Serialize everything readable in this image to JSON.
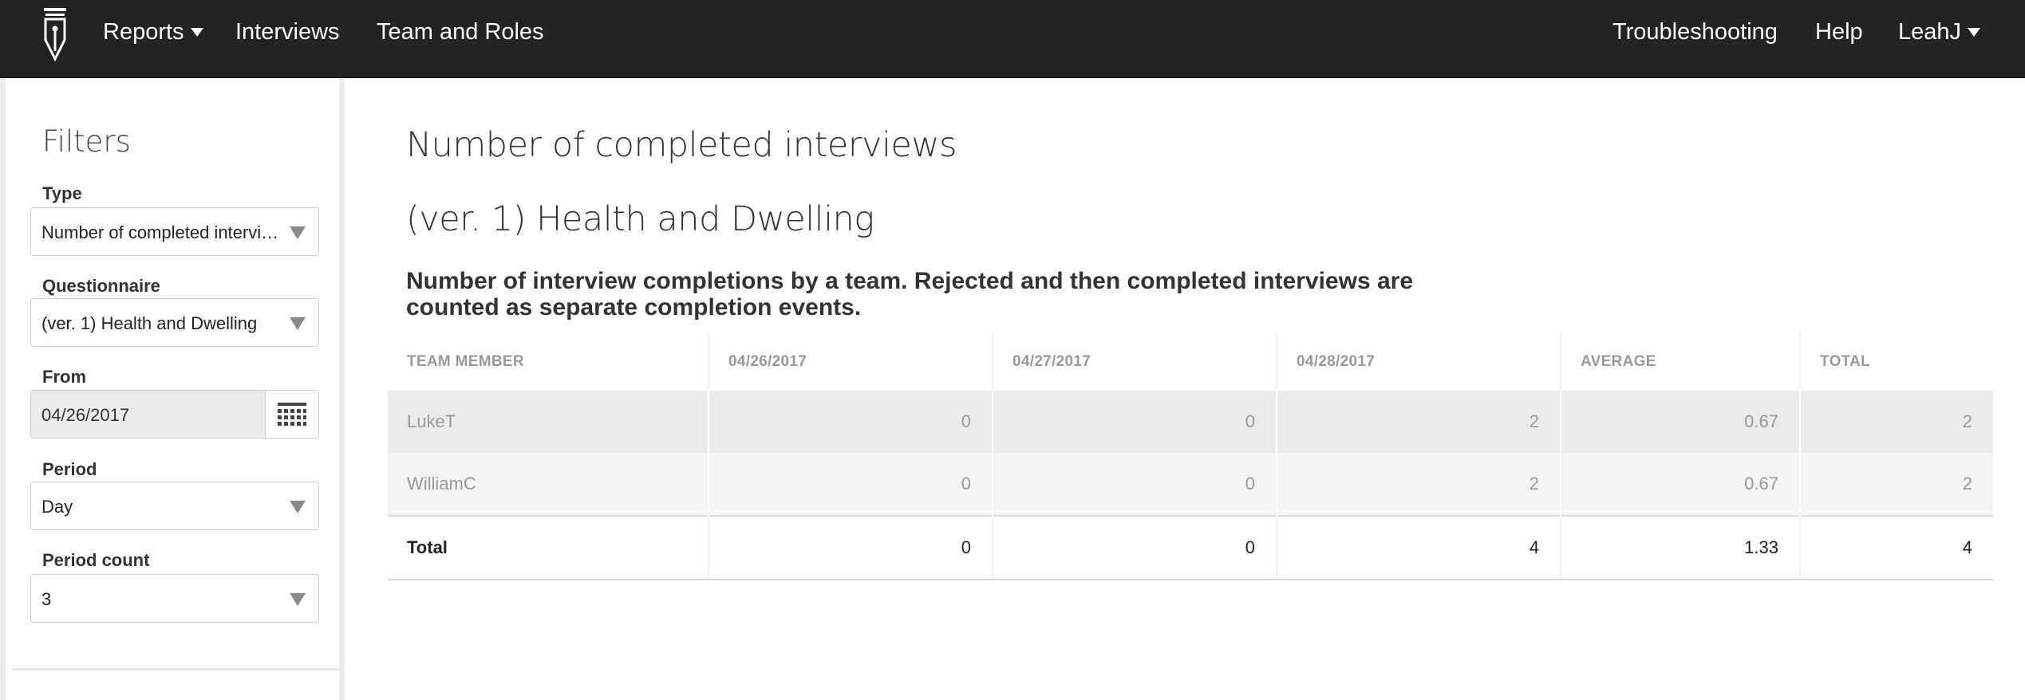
{
  "nav": {
    "reports": "Reports",
    "interviews": "Interviews",
    "team_and_roles": "Team and Roles",
    "troubleshooting": "Troubleshooting",
    "help": "Help",
    "user": "LeahJ"
  },
  "filters": {
    "title": "Filters",
    "type_label": "Type",
    "type_value": "Number of completed intervi…",
    "questionnaire_label": "Questionnaire",
    "questionnaire_value": "(ver. 1) Health and Dwelling",
    "from_label": "From",
    "from_value": "04/26/2017",
    "period_label": "Period",
    "period_value": "Day",
    "period_count_label": "Period count",
    "period_count_value": "3"
  },
  "report": {
    "title": "Number of completed interviews",
    "questionnaire": "(ver. 1) Health and Dwelling",
    "description": "Number of interview completions by a team. Rejected and then completed interviews are counted as separate completion events.",
    "columns": [
      "TEAM MEMBER",
      "04/26/2017",
      "04/27/2017",
      "04/28/2017",
      "AVERAGE",
      "TOTAL"
    ],
    "rows": [
      [
        "LukeT",
        "0",
        "0",
        "2",
        "0.67",
        "2"
      ],
      [
        "WilliamC",
        "0",
        "0",
        "2",
        "0.67",
        "2"
      ]
    ],
    "total_row": [
      "Total",
      "0",
      "0",
      "4",
      "1.33",
      "4"
    ]
  },
  "icons": {
    "logo": "pen-nib-logo",
    "calendar": "calendar-icon",
    "dropdown": "chevron-down-icon"
  }
}
